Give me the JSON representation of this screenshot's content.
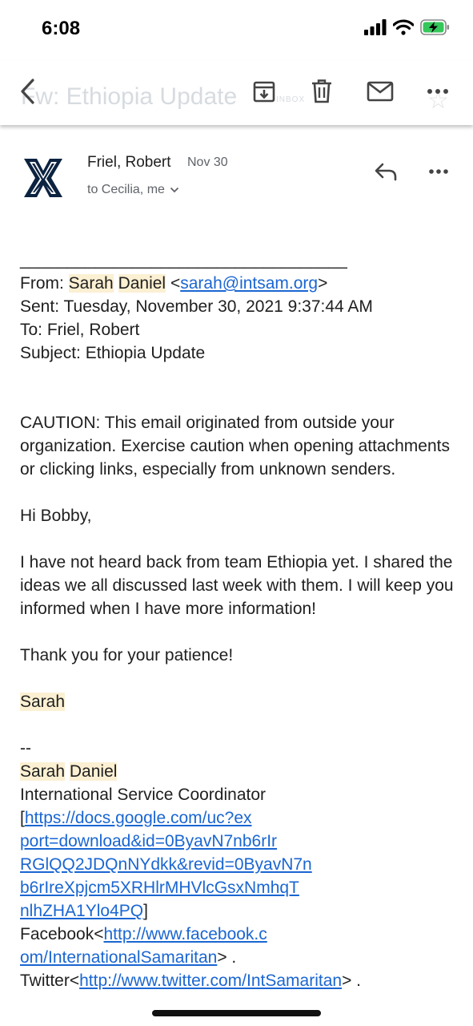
{
  "status": {
    "time": "6:08"
  },
  "toolbar": {
    "ghost_subject": "Fw: Ethiopia Update",
    "ghost_label": "INBOX"
  },
  "header": {
    "sender": "Friel, Robert",
    "date": "Nov 30",
    "recipients": "to Cecilia, me"
  },
  "email": {
    "rule": "___________________________________",
    "from_label": "From: ",
    "from_first": "Sarah",
    "from_last": "Daniel",
    "from_open": " <",
    "from_email": "sarah@intsam.org",
    "from_close": ">",
    "sent": "Sent: Tuesday, November 30, 2021 9:37:44 AM",
    "to": "To: Friel, Robert",
    "subject": "Subject: Ethiopia Update",
    "caution": "CAUTION: This email originated from outside your organization. Exercise caution when opening attachments or clicking links, especially from unknown senders.",
    "greeting": "Hi Bobby,",
    "paragraph": "I have not heard back from team Ethiopia yet. I shared the ideas we all discussed last week with them. I will keep you informed when I have more information!",
    "thanks": "Thank you for your patience!",
    "signoff": "Sarah",
    "dashes": "--",
    "sig_first": "Sarah",
    "sig_last": "Daniel",
    "sig_title": "International Service Coordinator",
    "bracket_open": "[",
    "doc_link_lines": [
      "https://docs.google.com/uc?ex",
      "port=download&id=0ByavN7nb6rIr",
      "RGlQQ2JDQnNYdkk&revid=0ByavN7n",
      "b6rIreXpjcm5XRHlrMHVlcGsxNmhqT",
      "nlhZHA1Ylo4PQ"
    ],
    "bracket_close": "]",
    "facebook_label": "Facebook<",
    "facebook_link_1": "http://www.facebook.c",
    "facebook_link_2": "om/InternationalSamaritan",
    "facebook_after": "> .",
    "twitter_label": "Twitter<",
    "twitter_link": "http://www.twitter.com/IntSamaritan",
    "twitter_after": "> ."
  },
  "icons": {
    "back": "chevron-left-icon",
    "archive": "archive-icon",
    "delete": "trash-icon",
    "mark_unread": "mail-icon",
    "more": "more-horizontal-icon",
    "reply": "reply-icon",
    "avatar": "xavier-x-logo"
  },
  "colors": {
    "link": "#1a66d2",
    "highlight": "#fcf0d3",
    "avatar_navy": "#0c2340",
    "battery_green": "#34c759"
  }
}
